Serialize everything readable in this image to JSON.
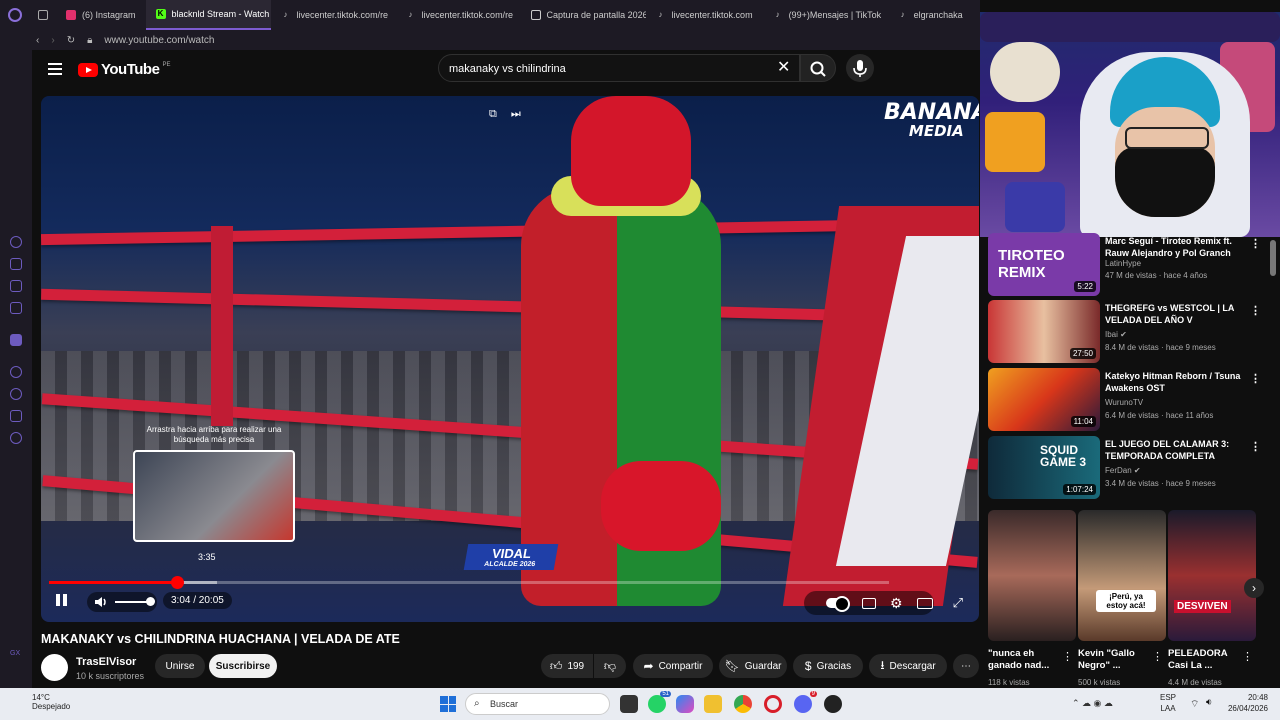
{
  "browser": {
    "tabs": [
      {
        "label": "(6) Instagram",
        "icon": "instagram-icon",
        "color": "#e1306c"
      },
      {
        "label": "blacknld Stream - Watch",
        "icon": "kick-icon",
        "color": "#53fc18",
        "active": true
      },
      {
        "label": "livecenter.tiktok.com/re",
        "icon": "tiktok-icon",
        "color": "#ffffff"
      },
      {
        "label": "livecenter.tiktok.com/re",
        "icon": "tiktok-icon",
        "color": "#ffffff"
      },
      {
        "label": "Captura de pantalla 2026",
        "icon": "file-icon",
        "color": "#cccccc"
      },
      {
        "label": "livecenter.tiktok.com",
        "icon": "tiktok-icon",
        "color": "#ffffff"
      },
      {
        "label": "(99+)Mensajes | TikTok",
        "icon": "tiktok-icon",
        "color": "#ffffff"
      },
      {
        "label": "elgranchaka",
        "icon": "tiktok-icon",
        "color": "#ffffff"
      }
    ],
    "url": "www.youtube.com/watch"
  },
  "youtube": {
    "logo_text": "YouTube",
    "country_code": "PE",
    "search_value": "makanaky vs chilindrina",
    "search_placeholder": "Buscar"
  },
  "player": {
    "drag_tip": "Arrastra hacia arriba para realizar una búsqueda más precisa",
    "preview_time": "3:35",
    "current_time": "3:04",
    "duration": "20:05",
    "time_display": "3:04 / 20:05",
    "progress_fraction": 0.1527,
    "buffered_fraction": 0.2,
    "volume_fraction": 1.0,
    "overlay_logo_line1": "BANANA",
    "overlay_logo_line2": "MEDIA",
    "sponsor_text": "ALCALDE 2026",
    "sponsor_name": "VIDAL",
    "accent_color": "#ff0000"
  },
  "video": {
    "title": "MAKANAKY vs CHILINDRINA HUACHANA | VELADA DE ATE",
    "channel_name": "TrasElVisor",
    "subscribers": "10 k suscriptores",
    "join_label": "Unirse",
    "subscribe_label": "Suscribirse",
    "like_count": "199",
    "share_label": "Compartir",
    "save_label": "Guardar",
    "thanks_label": "Gracias",
    "download_label": "Descargar"
  },
  "related": [
    {
      "title": "Marc Seguí - Tiroteo Remix ft. Rauw Alejandro y Pol Granch",
      "channel": "LatinHype",
      "meta": "47 M de vistas · hace 4 años",
      "duration": "5:22",
      "thumb_text": "TIROTEO REMIX",
      "thumb_color": "#7a3aa8"
    },
    {
      "title": "THEGREFG vs WESTCOL | LA VELADA DEL AÑO V",
      "channel": "Ibai",
      "meta": "8.4 M de vistas · hace 9 meses",
      "duration": "27:50",
      "thumb_text": "",
      "thumb_color": "#b92a2a"
    },
    {
      "title": "Katekyo Hitman Reborn / Tsuna Awakens OST",
      "channel": "WurunoTV",
      "meta": "6.4 M de vistas · hace 11 años",
      "duration": "11:04",
      "thumb_text": "",
      "thumb_color": "#d8661a"
    },
    {
      "title": "EL JUEGO DEL CALAMAR 3: TEMPORADA COMPLETA",
      "channel": "FerDan",
      "meta": "3.4 M de vistas · hace 9 meses",
      "duration": "1:07:24",
      "thumb_text": "SQUID GAME 3",
      "thumb_color": "#1a5a6a"
    }
  ],
  "shorts": [
    {
      "title": "\"nunca eh ganado nad...",
      "views": "118 k vistas",
      "overlay": "",
      "color": "#a86a5a"
    },
    {
      "title": "Kevin \"Gallo Negro\" ...",
      "views": "500 k vistas",
      "overlay": "¡Perú, ya estoy acá!",
      "color": "#c49a78"
    },
    {
      "title": "PELEADORA Casi La ...",
      "views": "4.4 M de vistas",
      "overlay": "DESVIVEN",
      "color": "#9a3030"
    }
  ],
  "taskbar": {
    "weather_temp": "14°C",
    "weather_desc": "Despejado",
    "search_label": "Buscar",
    "language": "ESP",
    "layout": "LAA",
    "time": "20:48",
    "date": "26/04/2026",
    "badge_whatsapp": "51",
    "badge_discord": "9"
  }
}
